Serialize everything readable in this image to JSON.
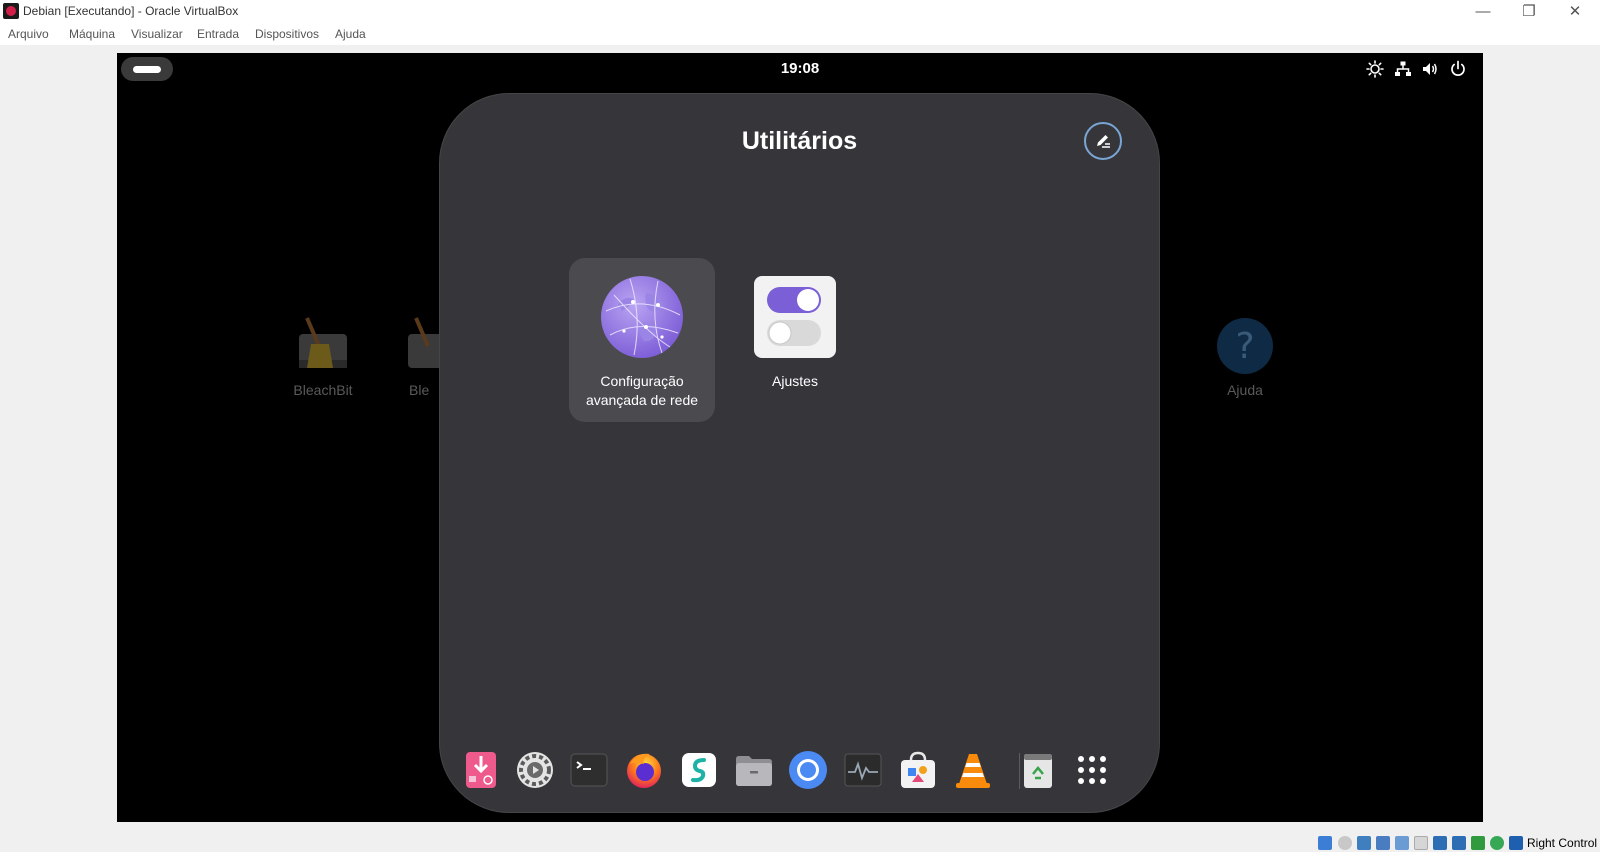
{
  "window": {
    "title": "Debian [Executando] - Oracle VirtualBox",
    "controls": {
      "minimize": "—",
      "maximize": "❐",
      "close": "✕"
    }
  },
  "menubar": [
    "Arquivo",
    "Máquina",
    "Visualizar",
    "Entrada",
    "Dispositivos",
    "Ajuda"
  ],
  "guest": {
    "clock": "19:08",
    "tray_icons": [
      "brightness-icon",
      "network-icon",
      "volume-icon",
      "power-icon"
    ],
    "background_apps": [
      {
        "label": "BleachBit",
        "icon": "bleachbit-icon"
      },
      {
        "label": "Ble",
        "icon": "bleachbit-icon"
      },
      {
        "label": "Ajuda",
        "icon": "help-icon"
      }
    ],
    "folder": {
      "title": "Utilitários",
      "apps": [
        {
          "label": "Configuração avançada de rede",
          "icon": "network-globe-icon",
          "selected": true
        },
        {
          "label": "Ajustes",
          "icon": "tweaks-toggle-icon",
          "selected": false
        }
      ]
    },
    "dock": [
      "installer-icon",
      "settings-gear-icon",
      "terminal-icon",
      "firefox-icon",
      "surfshark-icon",
      "files-folder-icon",
      "chromium-icon",
      "system-monitor-icon",
      "software-store-icon",
      "vlc-icon",
      "trash-icon",
      "app-grid-icon"
    ]
  },
  "statusbar": {
    "host_key": "Right Control"
  },
  "colors": {
    "folder_bg": "#36363a",
    "accent_purple": "#7a5fd6",
    "edit_ring": "#7aa6d6"
  }
}
